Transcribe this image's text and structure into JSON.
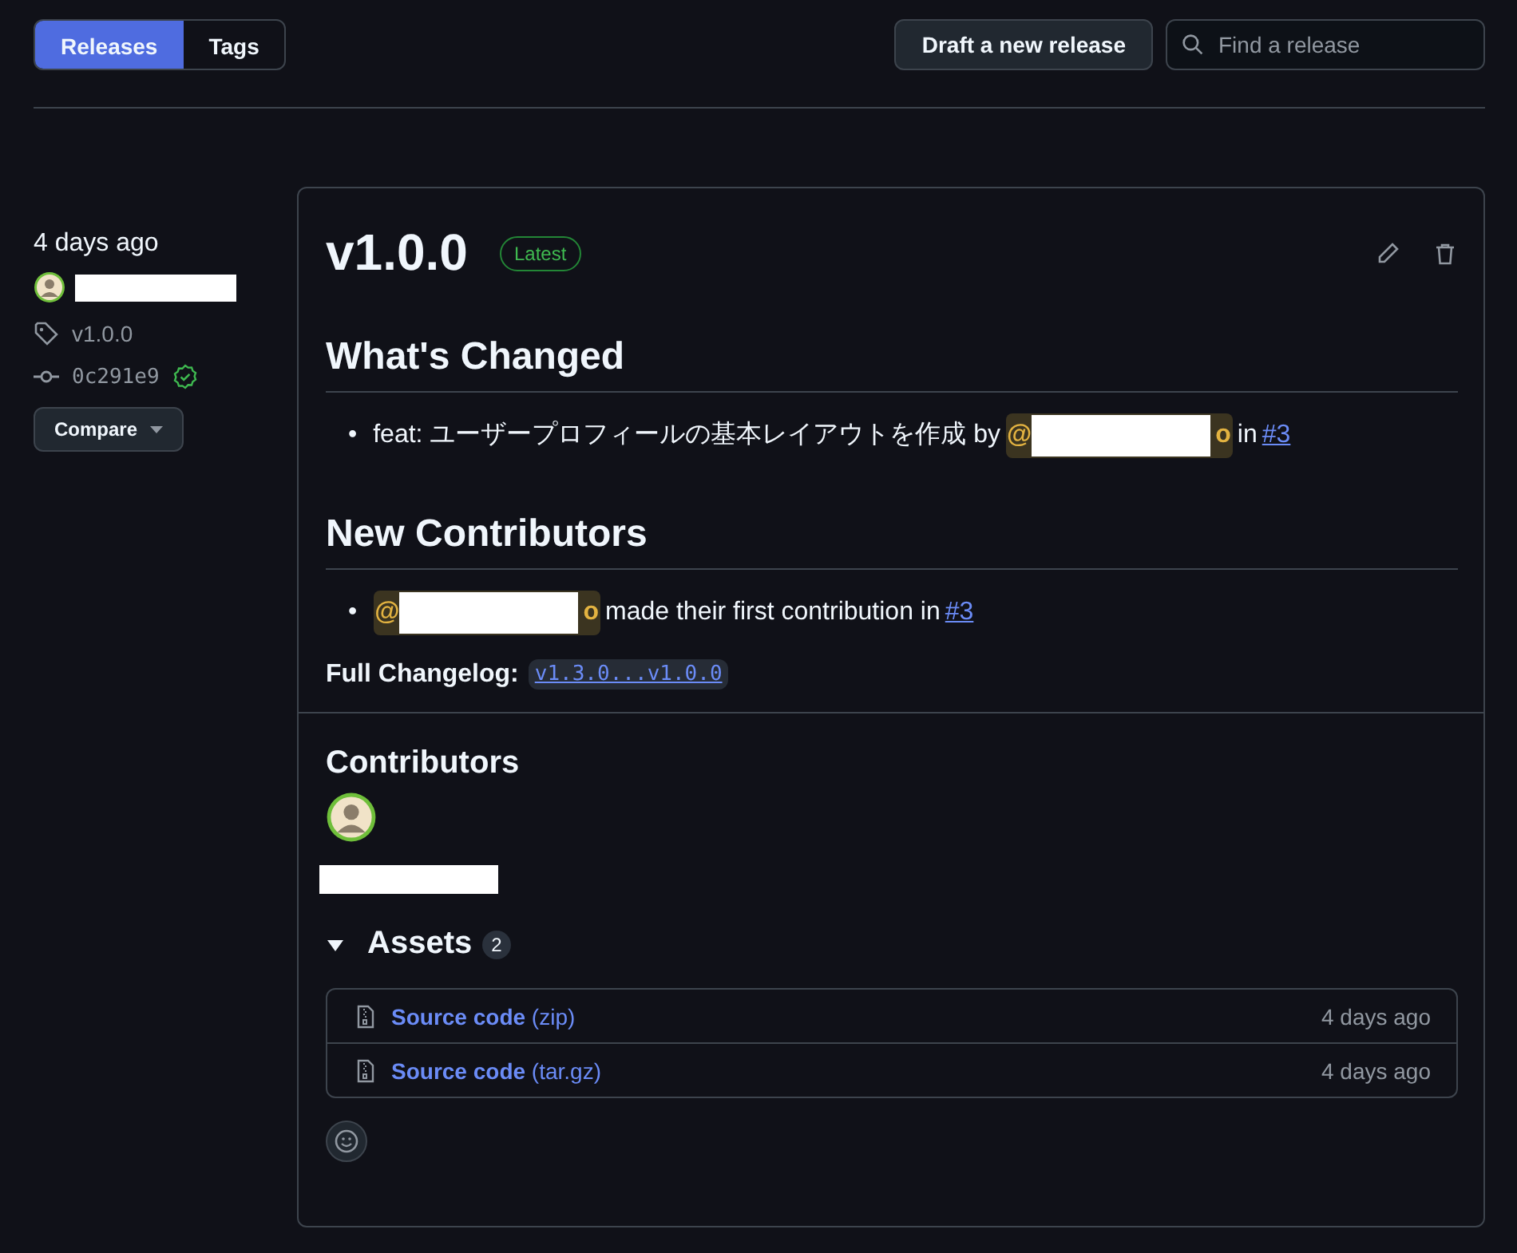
{
  "tabs": [
    {
      "label": "Releases",
      "selected": true
    },
    {
      "label": "Tags",
      "selected": false
    }
  ],
  "draft_button": "Draft a new release",
  "search": {
    "placeholder": "Find a release"
  },
  "sidebar": {
    "time": "4 days ago",
    "tag": "v1.0.0",
    "commit": "0c291e9",
    "verified": true,
    "compare_button": "Compare"
  },
  "release": {
    "title": "v1.0.0",
    "badge": "Latest",
    "sections": [
      {
        "heading": "What's Changed",
        "items": [
          {
            "bullet": "•",
            "before": "feat: ユーザープロフィールの基本レイアウトを作成 by",
            "mention": {
              "start": "@",
              "end": "o"
            },
            "after": "in",
            "link": "#3"
          }
        ]
      },
      {
        "heading": "New Contributors",
        "items": [
          {
            "bullet": "•",
            "mention": {
              "start": "@",
              "end": "o"
            },
            "after": "made their first contribution in",
            "link": "#3"
          }
        ]
      }
    ],
    "changelog_label": "Full Changelog:",
    "changelog_link": "v1.3.0...v1.0.0",
    "contributors_heading": "Contributors",
    "assets": {
      "title": "Assets",
      "count": "2",
      "expanded": true,
      "items": [
        {
          "name": "Source code",
          "format": "(zip)",
          "time": "4 days ago"
        },
        {
          "name": "Source code",
          "format": "(tar.gz)",
          "time": "4 days ago"
        }
      ]
    }
  }
}
